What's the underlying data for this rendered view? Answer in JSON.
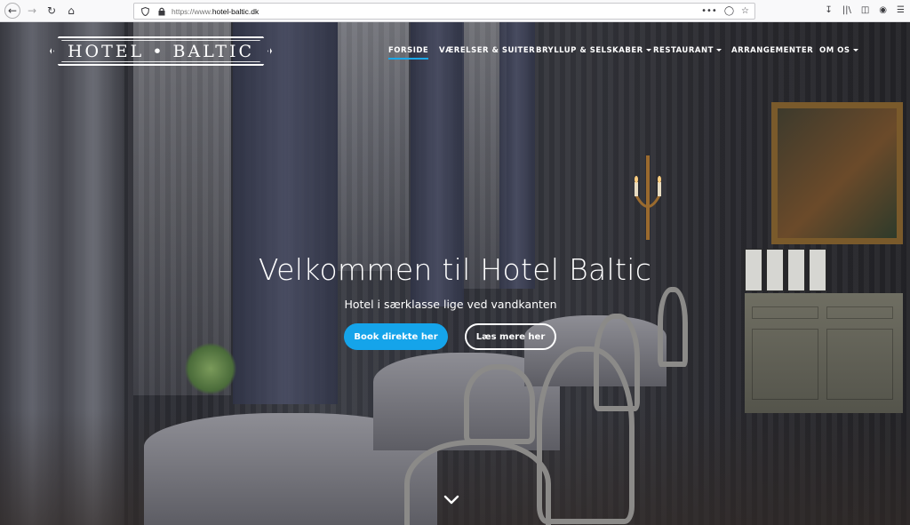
{
  "browser": {
    "url_prefix": "https://www.",
    "url_domain": "hotel-baltic.dk",
    "icons": [
      "back-icon",
      "forward-icon",
      "reload-icon",
      "home-icon",
      "shield-icon",
      "lock-icon",
      "more-icon",
      "pocket-icon",
      "bookmark-star-icon",
      "download-icon",
      "library-icon",
      "sidebar-icon",
      "account-icon",
      "menu-icon"
    ]
  },
  "site": {
    "logo_text": "HOTEL • BALTIC",
    "nav": [
      {
        "label": "FORSIDE",
        "active": true,
        "dropdown": false
      },
      {
        "label": "VÆRELSER & SUITER",
        "active": false,
        "dropdown": false
      },
      {
        "label": "BRYLLUP & SELSKABER",
        "active": false,
        "dropdown": true
      },
      {
        "label": "RESTAURANT",
        "active": false,
        "dropdown": true
      },
      {
        "label": "ARRANGEMENTER",
        "active": false,
        "dropdown": false
      },
      {
        "label": "OM OS",
        "active": false,
        "dropdown": true
      }
    ],
    "accent_color": "#15a4ea"
  },
  "hero": {
    "title": "Velkommen til Hotel Baltic",
    "subtitle": "Hotel i særklasse lige ved vandkanten",
    "primary_button": "Book direkte her",
    "secondary_button": "Læs mere her",
    "scroll_icon": "chevron-down-icon"
  }
}
